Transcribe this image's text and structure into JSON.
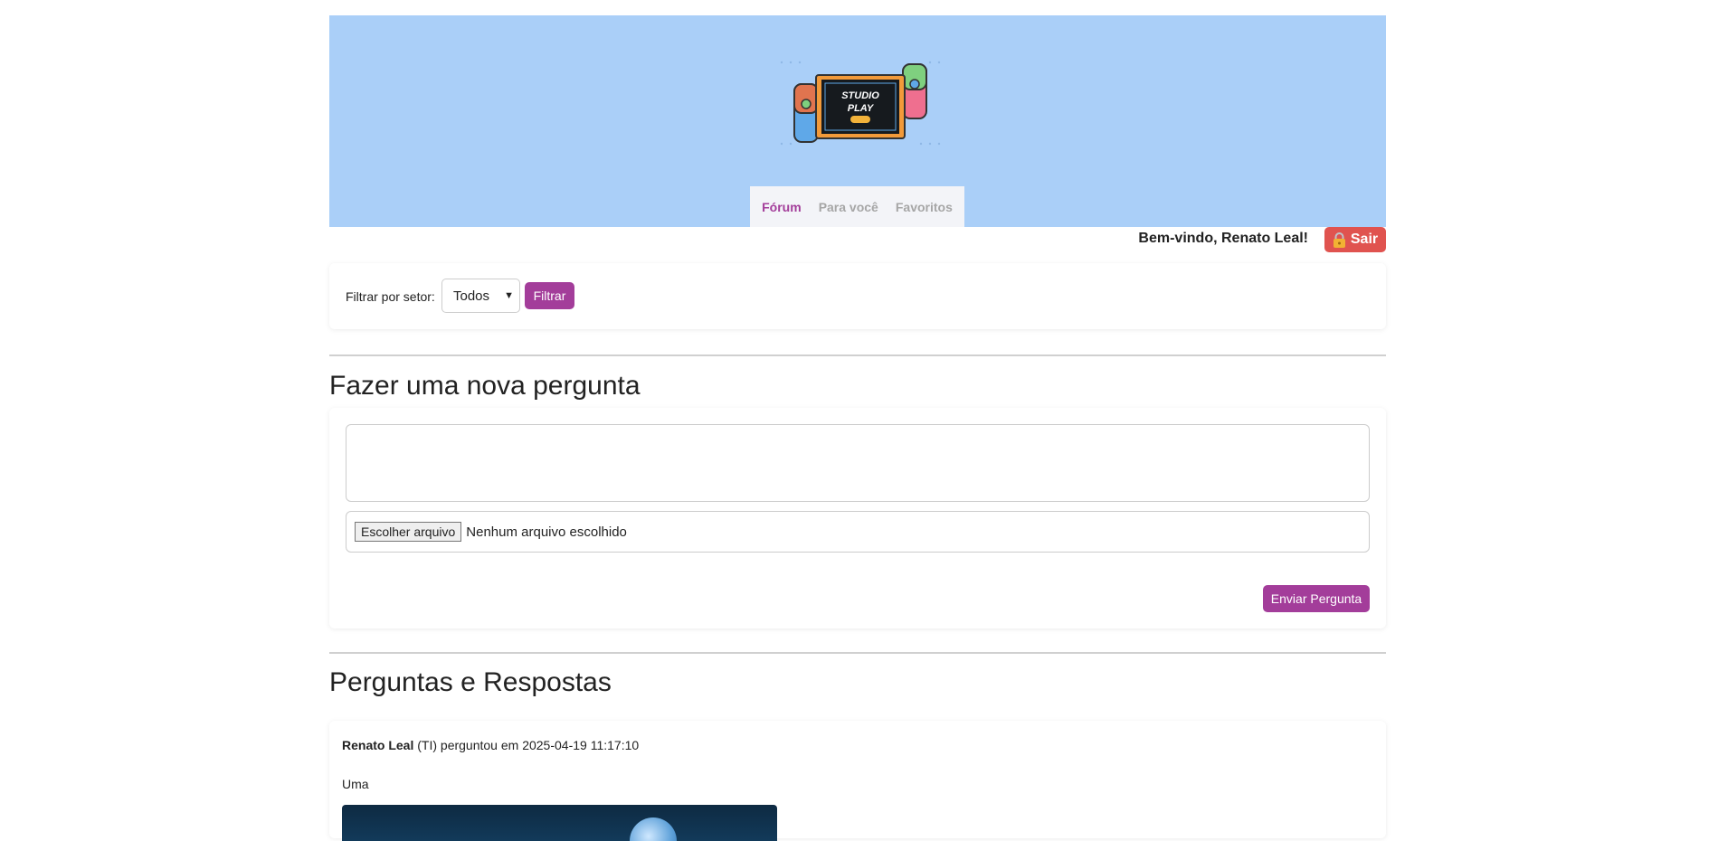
{
  "header": {
    "logo": {
      "line1": "STUDIO",
      "line2": "PLAY",
      "badge": ""
    },
    "tabs": [
      {
        "label": "Fórum",
        "active": true
      },
      {
        "label": "Para você",
        "active": false
      },
      {
        "label": "Favoritos",
        "active": false
      }
    ]
  },
  "user": {
    "welcome": "Bem-vindo, Renato Leal!",
    "logout_label": "Sair",
    "logout_icon": "lock-icon"
  },
  "filter": {
    "label": "Filtrar por setor:",
    "selected": "Todos",
    "button_label": "Filtrar"
  },
  "ask": {
    "title": "Fazer uma nova pergunta",
    "question_placeholder": "",
    "file_button": "Escolher arquivo",
    "file_status": "Nenhum arquivo escolhido",
    "submit_label": "Enviar Pergunta"
  },
  "feed": {
    "title": "Perguntas e Respostas",
    "posts": [
      {
        "author": "Renato Leal",
        "sector": "(TI)",
        "action": "perguntou em",
        "datetime": "2025-04-19 11:17:10",
        "text": "Uma"
      }
    ]
  },
  "colors": {
    "accent": "#a33d9a",
    "header_bg": "#aacff8",
    "logout_bg": "#e0534f"
  }
}
